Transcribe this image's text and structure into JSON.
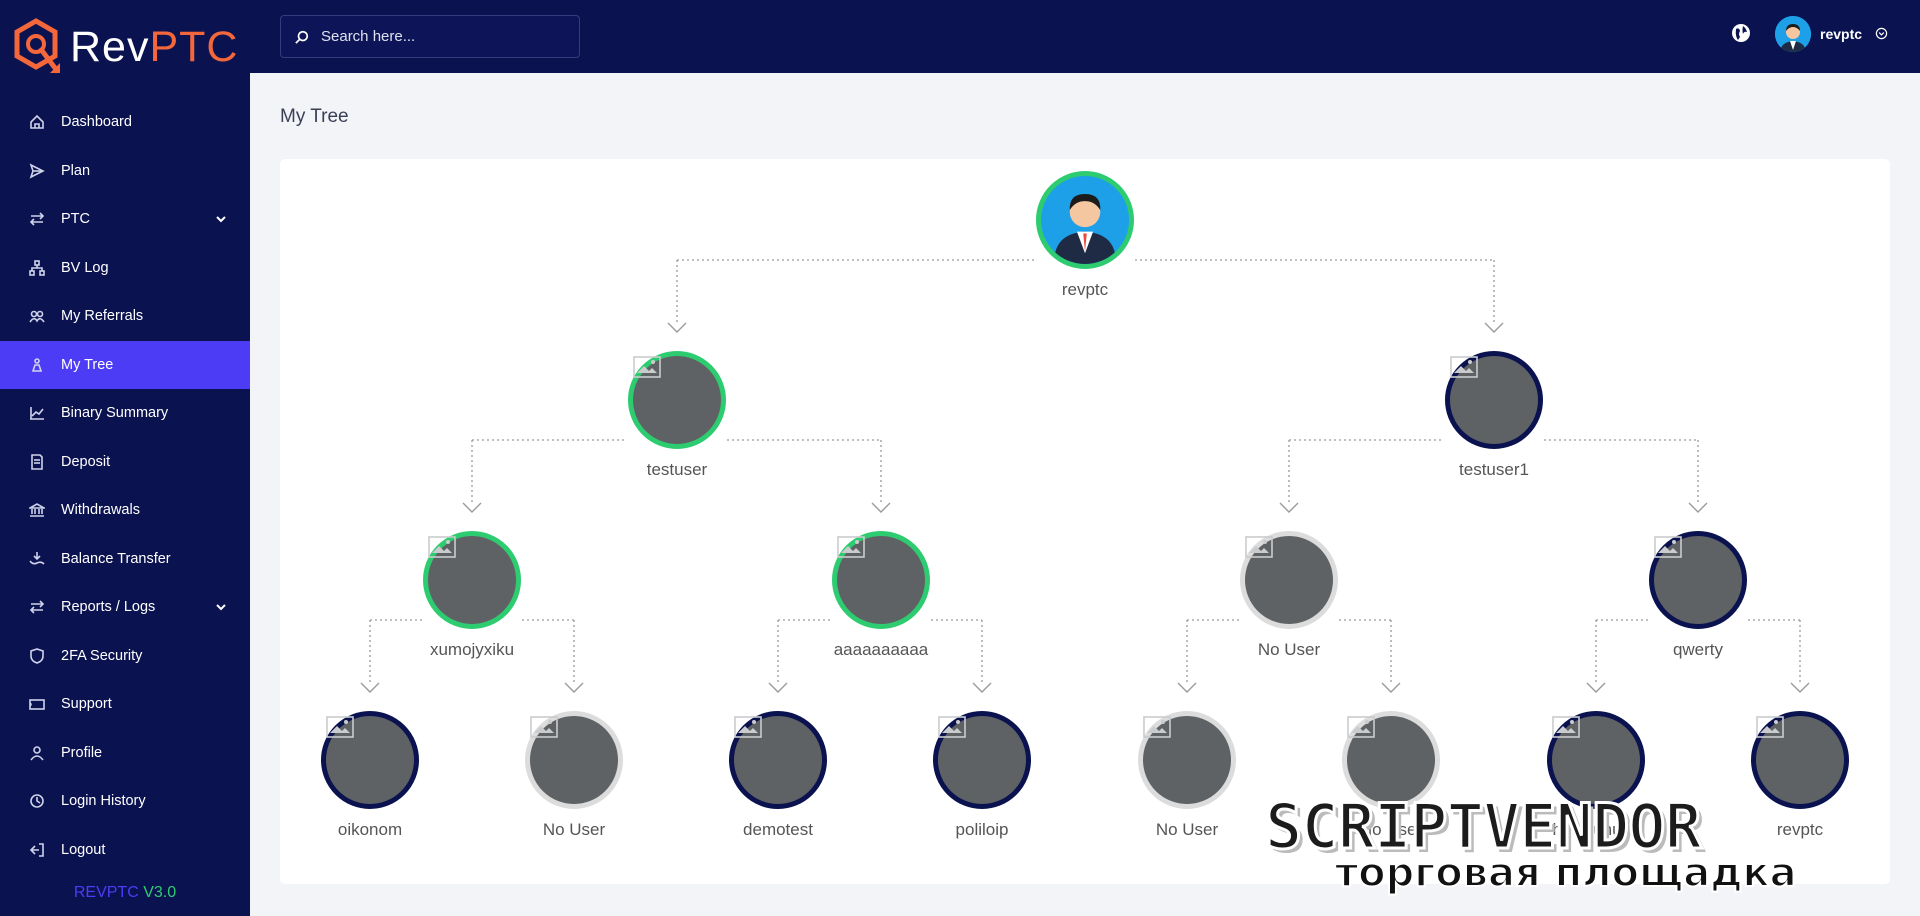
{
  "app": {
    "logo_part1": "Rev",
    "logo_part2": "PTC",
    "version_brand": "REVPTC",
    "version_number": "V3.0"
  },
  "colors": {
    "sidebar": "#0b1250",
    "active": "#4c3cf5",
    "brand_orange": "#f3673b",
    "node_green": "#2ecc71",
    "node_navy": "#0b1250",
    "node_empty": "#dcdcdc"
  },
  "search": {
    "placeholder": "Search here..."
  },
  "header": {
    "username": "revptc",
    "globe_icon": "globe-icon"
  },
  "sidebar": {
    "items": [
      {
        "label": "Dashboard",
        "icon": "home-icon"
      },
      {
        "label": "Plan",
        "icon": "send-icon"
      },
      {
        "label": "PTC",
        "icon": "arrows-icon",
        "has_submenu": true
      },
      {
        "label": "BV Log",
        "icon": "sitemap-icon"
      },
      {
        "label": "My Referrals",
        "icon": "users-icon"
      },
      {
        "label": "My Tree",
        "icon": "tree-icon",
        "active": true
      },
      {
        "label": "Binary Summary",
        "icon": "chart-icon"
      },
      {
        "label": "Deposit",
        "icon": "invoice-icon"
      },
      {
        "label": "Withdrawals",
        "icon": "bank-icon"
      },
      {
        "label": "Balance Transfer",
        "icon": "transfer-icon"
      },
      {
        "label": "Reports / Logs",
        "icon": "arrows-icon",
        "has_submenu": true
      },
      {
        "label": "2FA Security",
        "icon": "shield-icon"
      },
      {
        "label": "Support",
        "icon": "ticket-icon"
      },
      {
        "label": "Profile",
        "icon": "user-icon"
      },
      {
        "label": "Login History",
        "icon": "history-icon"
      },
      {
        "label": "Logout",
        "icon": "logout-icon"
      }
    ]
  },
  "page": {
    "title": "My Tree"
  },
  "tree": {
    "root": {
      "name": "revptc",
      "status": "active"
    },
    "level1": [
      {
        "name": "testuser",
        "status": "active"
      },
      {
        "name": "testuser1",
        "status": "paid"
      }
    ],
    "level2": [
      {
        "name": "xumojyxiku",
        "status": "active"
      },
      {
        "name": "aaaaaaaaaa",
        "status": "active"
      },
      {
        "name": "No User",
        "status": "empty"
      },
      {
        "name": "qwerty",
        "status": "paid"
      }
    ],
    "level3": [
      {
        "name": "oikonom",
        "status": "paid"
      },
      {
        "name": "No User",
        "status": "empty"
      },
      {
        "name": "demotest",
        "status": "paid"
      },
      {
        "name": "poliloip",
        "status": "paid"
      },
      {
        "name": "No User",
        "status": "empty"
      },
      {
        "name": "No User",
        "status": "empty"
      },
      {
        "name": "huuyjuhuhs",
        "status": "paid"
      },
      {
        "name": "revptc",
        "status": "paid"
      }
    ]
  },
  "watermark": {
    "line1": "SCRIPTVENDOR",
    "line2": "торговая площадка"
  }
}
